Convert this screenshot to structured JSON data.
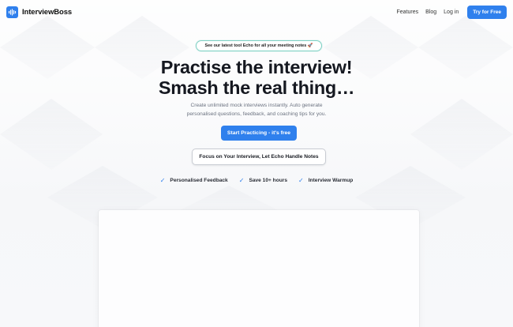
{
  "brand": {
    "name": "InterviewBoss",
    "accent": "#2f80ed",
    "pill_border": "#7fd1c4"
  },
  "nav": {
    "links": [
      "Features",
      "Blog",
      "Log in"
    ],
    "cta": "Try for Free"
  },
  "announcement": "See our latest tool Echo for all your meeting notes 🚀",
  "hero": {
    "title_line1": "Practise the interview!",
    "title_line2": "Smash the real thing…",
    "subtitle_line1": "Create unlimited mock interviews instantly. Auto generate",
    "subtitle_line2": "personalised questions, feedback, and coaching tips for you.",
    "primary_cta": "Start Practicing - it's free",
    "secondary_cta": "Focus on Your Interview, Let Echo Handle Notes"
  },
  "features": [
    "Personalised Feedback",
    "Save 10+ hours",
    "Interview Warmup"
  ],
  "icons": {
    "logo": "audio-wave-icon",
    "check": "check-icon"
  }
}
